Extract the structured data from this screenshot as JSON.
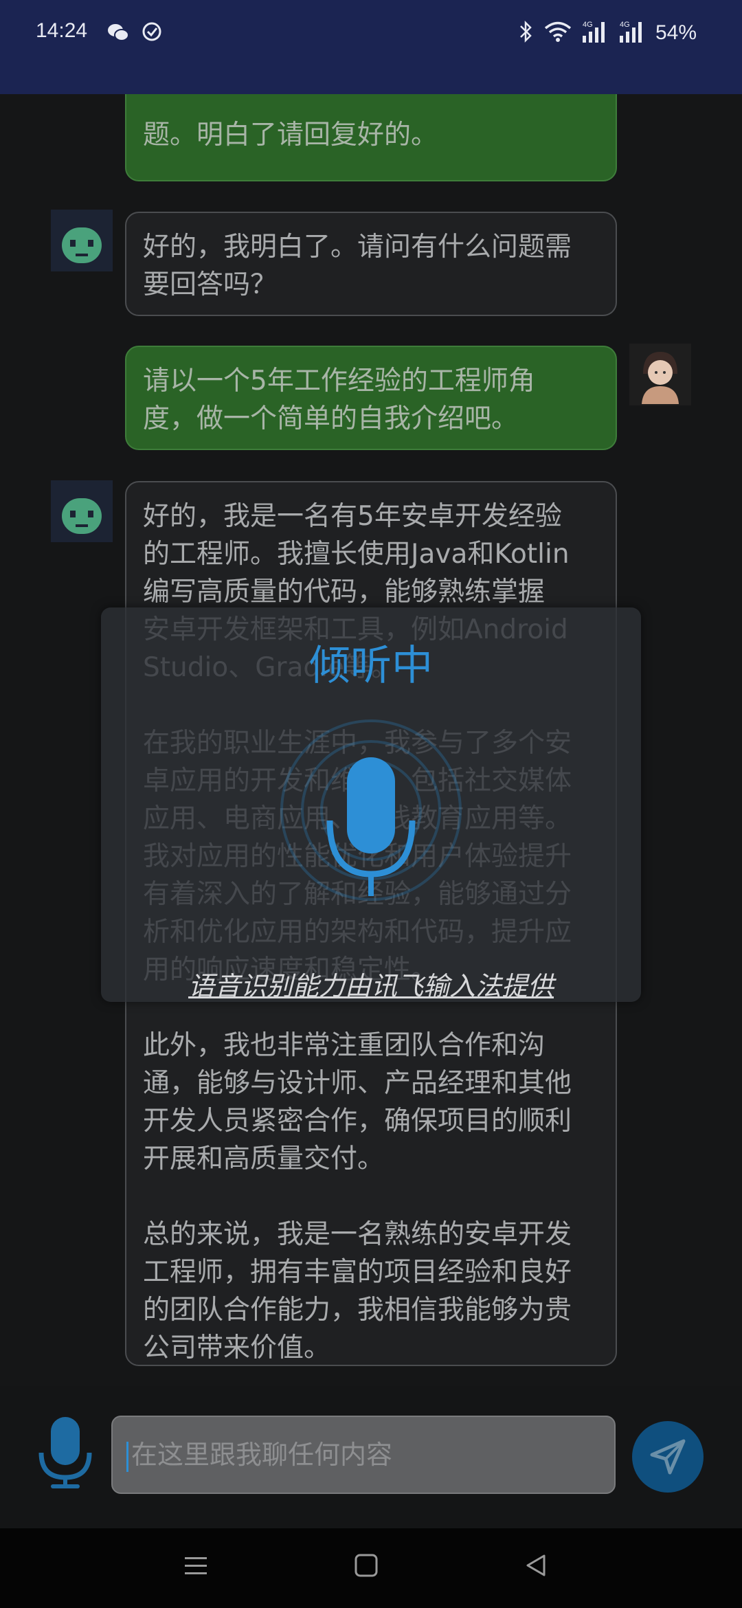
{
  "status_bar": {
    "time": "14:24",
    "battery": "54%",
    "network_labels": [
      "4G",
      "4G"
    ]
  },
  "chat": {
    "messages": [
      {
        "role": "user",
        "text": "题。明白了请回复好的。"
      },
      {
        "role": "bot",
        "text": "好的，我明白了。请问有什么问题需\n要回答吗？"
      },
      {
        "role": "user",
        "text": "请以一个5年工作经验的工程师角\n度，做一个简单的自我介绍吧。"
      },
      {
        "role": "bot",
        "text": "好的，我是一名有5年安卓开发经验\n的工程师。我擅长使用Java和Kotlin\n编写高质量的代码，能够熟练掌握\n安卓开发框架和工具，例如Android\nStudio、Gradle等。\n\n在我的职业生涯中，我参与了多个安\n卓应用的开发和维护，包括社交媒体\n应用、电商应用、在线教育应用等。\n我对应用的性能优化和用户体验提升\n有着深入的了解和经验，能够通过分\n析和优化应用的架构和代码，提升应\n用的响应速度和稳定性。\n\n此外，我也非常注重团队合作和沟\n通，能够与设计师、产品经理和其他\n开发人员紧密合作，确保项目的顺利\n开展和高质量交付。\n\n总的来说，我是一名熟练的安卓开发\n工程师，拥有丰富的项目经验和良好\n的团队合作能力，我相信我能够为贵\n公司带来价值。"
      }
    ]
  },
  "listening_dialog": {
    "title": "倾听中",
    "provider": "语音识别能力由讯飞输入法提供"
  },
  "input": {
    "placeholder": "在这里跟我聊任何内容"
  },
  "colors": {
    "accent": "#2d8fd6",
    "user_bubble": "#2a6326",
    "status_bar": "#1b2452"
  }
}
